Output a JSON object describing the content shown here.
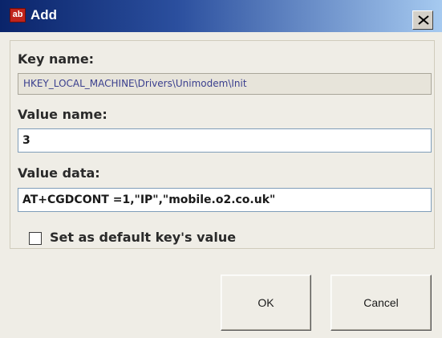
{
  "window": {
    "title": "Add",
    "app_icon_text": "ab",
    "app_icon_name": "registry-string-icon",
    "close_icon_name": "close-icon"
  },
  "form": {
    "key_name_label": "Key name:",
    "key_name_value": "HKEY_LOCAL_MACHINE\\Drivers\\Unimodem\\Init",
    "value_name_label": "Value name:",
    "value_name_value": "3",
    "value_data_label": "Value data:",
    "value_data_value": "AT+CGDCONT =1,\"IP\",\"mobile.o2.co.uk\"",
    "default_checkbox_label": "Set as default key's value",
    "default_checkbox_checked": false
  },
  "buttons": {
    "ok_label": "OK",
    "cancel_label": "Cancel"
  },
  "colors": {
    "titlebar_start": "#0a246a",
    "titlebar_end": "#a6caf0",
    "dialog_background": "#efede6",
    "readonly_text": "#3a3f8e"
  }
}
